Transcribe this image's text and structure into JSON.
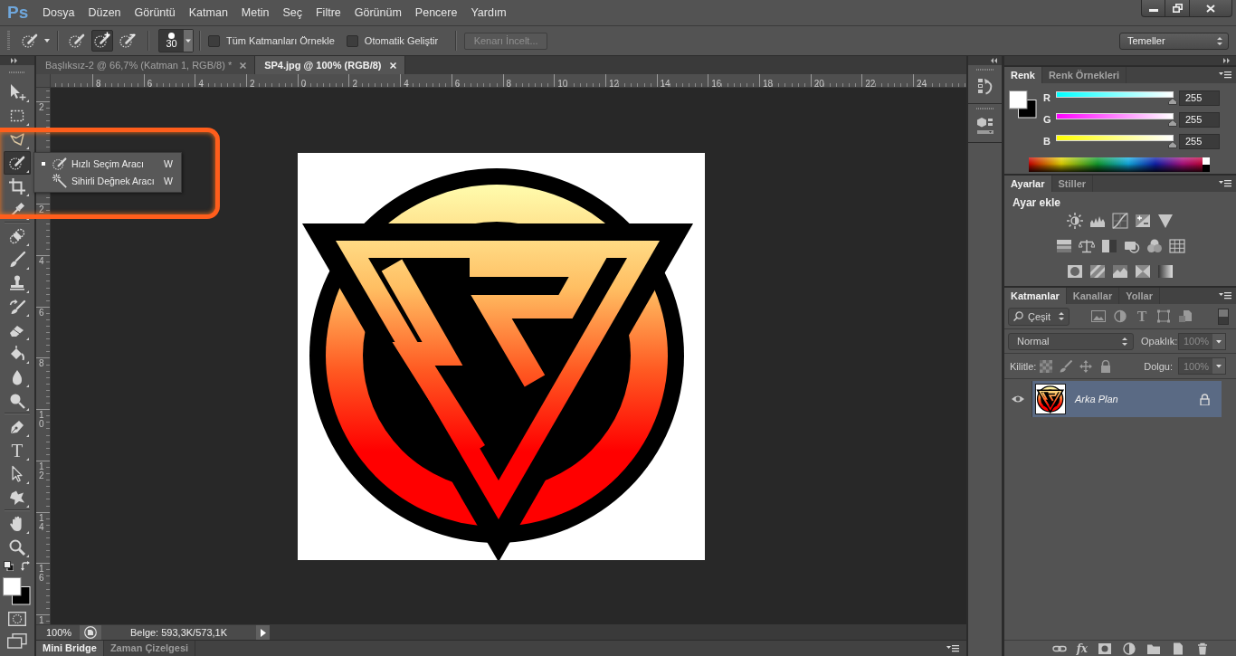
{
  "app": {
    "logo": "Ps"
  },
  "menu": [
    "Dosya",
    "Düzen",
    "Görüntü",
    "Katman",
    "Metin",
    "Seç",
    "Filtre",
    "Görünüm",
    "Pencere",
    "Yardım"
  ],
  "window_controls": [
    {
      "kind": "minimize"
    },
    {
      "kind": "restore"
    },
    {
      "kind": "close"
    }
  ],
  "options_bar": {
    "tool_preset": {
      "kind": "quick-selection"
    },
    "brush_modes": [
      {
        "kind": "new",
        "selected": false
      },
      {
        "kind": "add",
        "selected": true
      },
      {
        "kind": "subtract",
        "selected": false
      }
    ],
    "brush_size": "30",
    "checkboxes": [
      {
        "label": "Tüm Katmanları Örnekle",
        "checked": false
      },
      {
        "label": "Otomatik Geliştir",
        "checked": false
      }
    ],
    "refine_edge": {
      "label": "Kenarı İncelt...",
      "disabled": true
    },
    "workspace": "Temeller"
  },
  "toolbar": {
    "tool_groups": [
      [
        {
          "kind": "move",
          "selected": false
        },
        {
          "kind": "marquee",
          "selected": false
        },
        {
          "kind": "lasso",
          "selected": false
        },
        {
          "kind": "quick-selection",
          "selected": true
        },
        {
          "kind": "crop",
          "selected": false
        },
        {
          "kind": "eyedropper",
          "selected": false
        }
      ],
      [
        {
          "kind": "healing",
          "selected": false
        },
        {
          "kind": "brush",
          "selected": false
        },
        {
          "kind": "stamp",
          "selected": false
        },
        {
          "kind": "history-brush",
          "selected": false
        },
        {
          "kind": "eraser",
          "selected": false
        },
        {
          "kind": "bucket",
          "selected": false
        },
        {
          "kind": "blur",
          "selected": false
        },
        {
          "kind": "dodge",
          "selected": false
        }
      ],
      [
        {
          "kind": "pen",
          "selected": false
        },
        {
          "kind": "type",
          "glyph": "T",
          "selected": false
        },
        {
          "kind": "path-selection",
          "selected": false
        },
        {
          "kind": "shape",
          "selected": false
        }
      ],
      [
        {
          "kind": "hand",
          "selected": false
        },
        {
          "kind": "zoom",
          "selected": false
        }
      ]
    ],
    "swatches": [
      {
        "kind": "foreground",
        "color": "#ffffff"
      },
      {
        "kind": "background",
        "color": "#000000"
      }
    ]
  },
  "flyout": {
    "items": [
      {
        "kind": "quick-selection",
        "label": "Hızlı Seçim Aracı",
        "shortcut": "W",
        "selected": true
      },
      {
        "kind": "magic-wand",
        "label": "Sihirli Değnek Aracı",
        "shortcut": "W",
        "selected": false
      }
    ]
  },
  "annotations": [
    {
      "kind": "highlight-frame"
    }
  ],
  "document_tabs": [
    {
      "title": "Başlıksız-2 @ 66,7% (Katman 1, RGB/8) *",
      "selected": false
    },
    {
      "title": "SP4.jpg @ 100% (RGB/8)",
      "selected": true
    }
  ],
  "rulers": {
    "horizontal": [
      "8",
      "6",
      "4",
      "2",
      "0",
      "2",
      "4",
      "6",
      "8",
      "10",
      "12",
      "14",
      "16",
      "18",
      "20",
      "22",
      "24"
    ],
    "vertical": [
      "2",
      "2",
      "4",
      "6",
      "8",
      "10",
      "12",
      "14",
      "16",
      "1"
    ]
  },
  "status_bar": {
    "zoom": "100%",
    "info": "Belge: 593,3K/573,1K"
  },
  "bottom_tabs": [
    {
      "label": "Mini Bridge",
      "selected": true
    },
    {
      "label": "Zaman Çizelgesi",
      "selected": false
    }
  ],
  "dock": [
    {
      "kind": "history"
    },
    {
      "kind": "model"
    }
  ],
  "color_panel": {
    "tabs": [
      {
        "label": "Renk",
        "selected": true
      },
      {
        "label": "Renk Örnekleri",
        "selected": false
      }
    ],
    "swatches": [
      {
        "kind": "foreground",
        "color": "#ffffff"
      },
      {
        "kind": "background",
        "color": "#000000"
      }
    ],
    "channels": [
      {
        "kind": "red",
        "name": "R",
        "value": "255",
        "level": 1
      },
      {
        "kind": "green",
        "name": "G",
        "value": "255",
        "level": 1
      },
      {
        "kind": "blue",
        "name": "B",
        "value": "255",
        "level": 1
      }
    ]
  },
  "adjustments_panel": {
    "tabs": [
      {
        "label": "Ayarlar",
        "selected": true
      },
      {
        "label": "Stiller",
        "selected": false
      }
    ],
    "title": "Ayar ekle",
    "rows": [
      [
        {
          "kind": "brightness"
        },
        {
          "kind": "levels"
        },
        {
          "kind": "curves"
        },
        {
          "kind": "exposure"
        },
        {
          "kind": "vibrance"
        }
      ],
      [
        {
          "kind": "hue-saturation"
        },
        {
          "kind": "color-balance"
        },
        {
          "kind": "black-white"
        },
        {
          "kind": "photo-filter"
        },
        {
          "kind": "channel-mixer"
        },
        {
          "kind": "color-lookup"
        }
      ],
      [
        {
          "kind": "invert"
        },
        {
          "kind": "posterize"
        },
        {
          "kind": "threshold"
        },
        {
          "kind": "selective-color"
        },
        {
          "kind": "gradient-map"
        }
      ]
    ]
  },
  "layers_panel": {
    "tabs": [
      {
        "label": "Katmanlar",
        "selected": true
      },
      {
        "label": "Kanallar",
        "selected": false
      },
      {
        "label": "Yollar",
        "selected": false
      }
    ],
    "filter": {
      "label": "Çeşit",
      "icons": [
        {
          "kind": "image"
        },
        {
          "kind": "adjustment"
        },
        {
          "kind": "type",
          "glyph": "T"
        },
        {
          "kind": "shape"
        },
        {
          "kind": "smart-object"
        }
      ],
      "enabled": false
    },
    "blend_mode": "Normal",
    "opacity": {
      "label": "Opaklık:",
      "value": "100%",
      "disabled": true
    },
    "lock": {
      "label": "Kilitle:",
      "icons": [
        {
          "kind": "pixels"
        },
        {
          "kind": "paint"
        },
        {
          "kind": "position"
        },
        {
          "kind": "all"
        }
      ]
    },
    "fill": {
      "label": "Dolgu:",
      "value": "100%",
      "disabled": true
    },
    "layers": [
      {
        "name": "Arka Plan",
        "visible": true,
        "locked": true,
        "selected": true
      }
    ],
    "footer": [
      {
        "kind": "link"
      },
      {
        "kind": "fx",
        "glyph": "fx"
      },
      {
        "kind": "mask"
      },
      {
        "kind": "adjustment"
      },
      {
        "kind": "group"
      },
      {
        "kind": "new"
      },
      {
        "kind": "delete"
      }
    ]
  }
}
